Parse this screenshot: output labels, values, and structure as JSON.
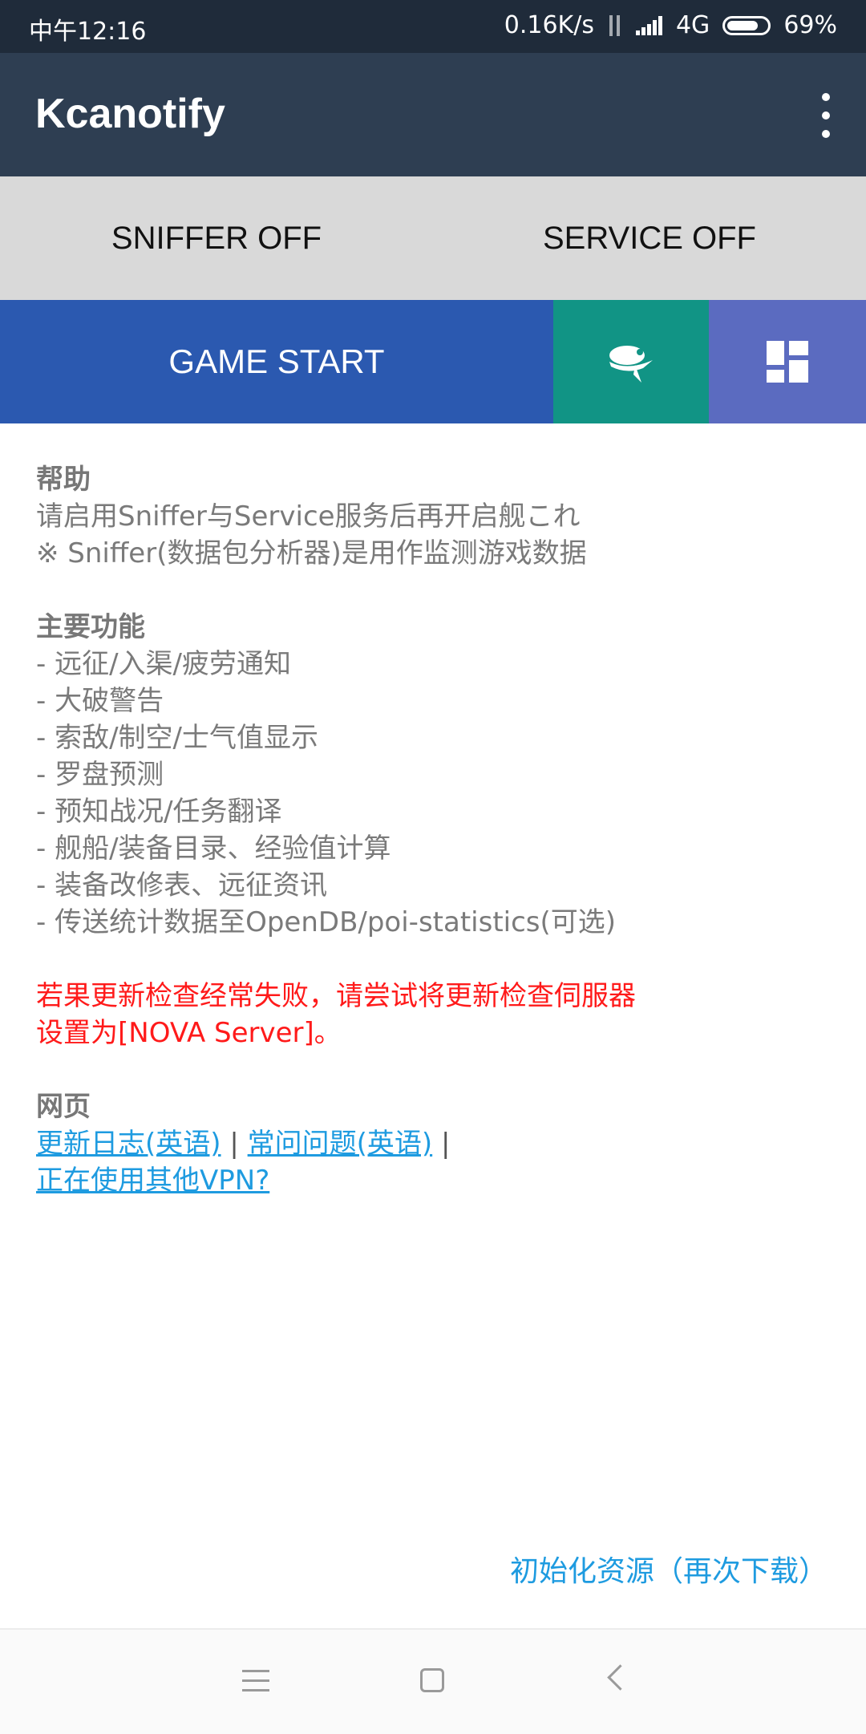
{
  "status": {
    "time": "中午12:16",
    "speed": "0.16K/s",
    "network": "4G",
    "battery": "69%"
  },
  "appbar": {
    "title": "Kcanotify"
  },
  "toggles": {
    "sniffer": "SNIFFER OFF",
    "service": "SERVICE OFF"
  },
  "actions": {
    "game_start": "GAME START"
  },
  "help": {
    "heading": "帮助",
    "line1": "请启用Sniffer与Service服务后再开启舰これ",
    "line2": "※ Sniffer(数据包分析器)是用作监测游戏数据"
  },
  "features": {
    "heading": "主要功能",
    "items": [
      "- 远征/入渠/疲劳通知",
      "- 大破警告",
      "- 索敌/制空/士气值显示",
      "- 罗盘预测",
      "- 预知战况/任务翻译",
      "- 舰船/装备目录、经验值计算",
      "- 装备改修表、远征资讯",
      "- 传送统计数据至OpenDB/poi-statistics(可选)"
    ]
  },
  "warning": {
    "line1": "若果更新检查经常失败，请尝试将更新检查伺服器",
    "line2": "设置为[NOVA Server]。"
  },
  "web": {
    "heading": "网页",
    "changelog": "更新日志(英语)",
    "faq": "常问问题(英语)",
    "vpn": "正在使用其他VPN?",
    "separator": "|"
  },
  "reinit": "初始化资源（再次下载）",
  "colors": {
    "statusbar": "#1f2b3a",
    "appbar": "#2e3e52",
    "game_start": "#2b59b0",
    "teal": "#119485",
    "indigo": "#5b6bc0",
    "warning": "#ff1a1a",
    "link": "#1e9be0"
  }
}
